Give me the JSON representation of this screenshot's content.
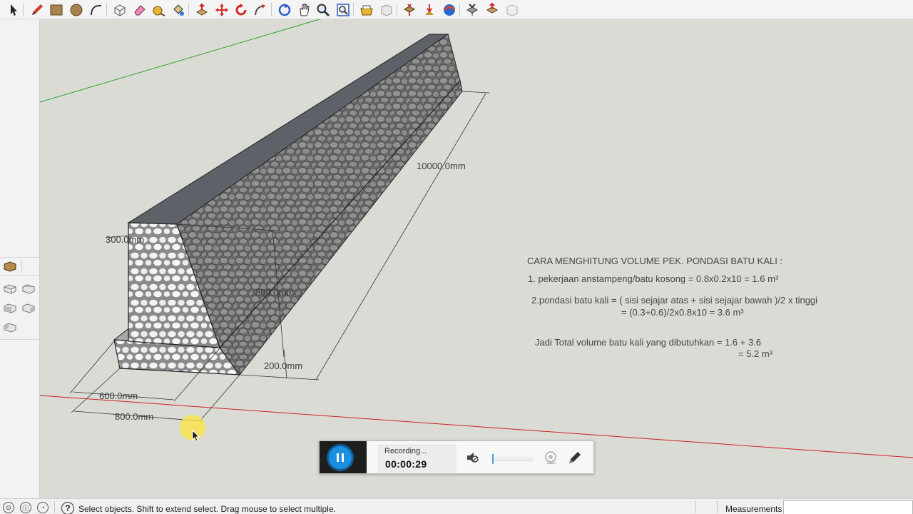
{
  "toolbar": {
    "items": [
      {
        "icon": "select-arrow-icon"
      },
      {
        "icon": "pencil-line-icon"
      },
      {
        "icon": "rectangle-icon"
      },
      {
        "icon": "circle-icon"
      },
      {
        "icon": "arc-icon"
      },
      {
        "icon": "make-component-icon"
      },
      {
        "icon": "eraser-icon"
      },
      {
        "icon": "tape-measure-icon"
      },
      {
        "icon": "paint-bucket-icon"
      },
      {
        "icon": "push-pull-icon"
      },
      {
        "icon": "move-icon"
      },
      {
        "icon": "rotate-icon"
      },
      {
        "icon": "follow-me-icon"
      },
      {
        "icon": "orbit-icon"
      },
      {
        "icon": "pan-icon"
      },
      {
        "icon": "zoom-icon"
      },
      {
        "icon": "zoom-extents-icon"
      },
      {
        "icon": "get-models-icon"
      },
      {
        "icon": "share-model-icon"
      },
      {
        "icon": "share-component-icon"
      },
      {
        "icon": "extension-warehouse-icon"
      },
      {
        "icon": "send-to-layout-icon"
      },
      {
        "icon": "geo-location-icon"
      },
      {
        "icon": "add-location-icon"
      },
      {
        "icon": "toggle-terrain-icon"
      },
      {
        "icon": "photo-textures-icon"
      }
    ]
  },
  "viewport": {
    "dimensions": {
      "length": "10000.0mm",
      "top_width": "300.0mm",
      "height": "800.0mm",
      "footing_height": "200.0mm",
      "bottom_width": "600.0mm",
      "footing_width": "800.0mm"
    },
    "notes": {
      "title": "CARA MENGHITUNG VOLUME PEK. PONDASI BATU KALI :",
      "line1": "1. pekerjaan anstampeng/batu kosong = 0.8x0.2x10 = 1.6 m³",
      "line2a": "2.pondasi batu kali = ( sisi sejajar atas + sisi sejajar bawah )/2 x tinggi",
      "line2b": "= (0.3+0.6)/2x0.8x10 = 3.6 m³",
      "total_a": "Jadi Total volume batu kali yang dibutuhkan = 1.6 + 3.6",
      "total_b": "= 5.2 m³"
    }
  },
  "recorder": {
    "status": "Recording...",
    "time": "00:00:29",
    "volume": 0.0
  },
  "statusbar": {
    "hint": "Select objects. Shift to extend select. Drag mouse to select multiple.",
    "measurements_label": "Measurements",
    "measurements_value": ""
  }
}
